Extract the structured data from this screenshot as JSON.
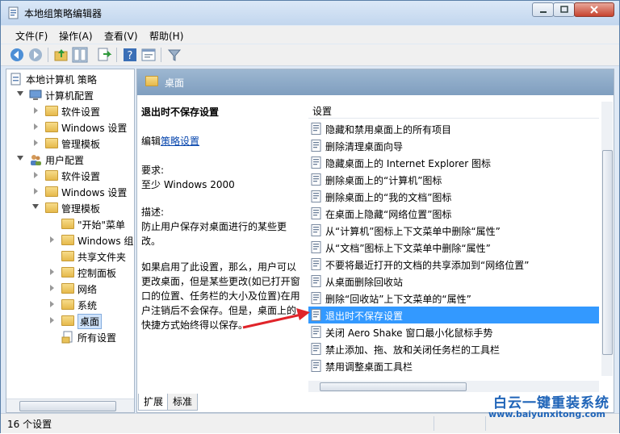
{
  "window": {
    "title": "本地组策略编辑器"
  },
  "menu": [
    "文件(F)",
    "操作(A)",
    "查看(V)",
    "帮助(H)"
  ],
  "toolbar": {
    "icons": [
      "back-icon",
      "forward-icon",
      "up-folder-icon",
      "show-hide-tree-icon",
      "export-list-icon",
      "help-icon",
      "properties-icon",
      "filter-icon"
    ]
  },
  "tree": {
    "root": "本地计算机 策略",
    "computer_config": "计算机配置",
    "cc_software": "软件设置",
    "cc_windows": "Windows 设置",
    "cc_admin": "管理模板",
    "user_config": "用户配置",
    "uc_software": "软件设置",
    "uc_windows": "Windows 设置",
    "uc_admin": "管理模板",
    "start_menu": "\"开始\"菜单",
    "windows_components": "Windows 组件",
    "shared_folders": "共享文件夹",
    "control_panel": "控制面板",
    "network": "网络",
    "system": "系统",
    "desktop": "桌面",
    "all_settings": "所有设置"
  },
  "panel": {
    "header": "桌面"
  },
  "description": {
    "title": "退出时不保存设置",
    "edit_prefix": "编辑",
    "edit_link": "策略设置",
    "req_label": "要求:",
    "req_value": "至少 Windows 2000",
    "desc_label": "描述:",
    "desc_text": "防止用户保存对桌面进行的某些更改。",
    "desc_more": "如果启用了此设置，那么，用户可以更改桌面，但是某些更改(如已打开窗口的位置、任务栏的大小及位置)在用户注销后不会保存。但是，桌面上的快捷方式始终得以保存。"
  },
  "list": {
    "column": "设置",
    "items": [
      "隐藏和禁用桌面上的所有项目",
      "删除清理桌面向导",
      "隐藏桌面上的 Internet Explorer 图标",
      "删除桌面上的“计算机”图标",
      "删除桌面上的“我的文档”图标",
      "在桌面上隐藏“网络位置”图标",
      "从“计算机”图标上下文菜单中删除“属性”",
      "从“文档”图标上下文菜单中删除“属性”",
      "不要将最近打开的文档的共享添加到“网络位置”",
      "从桌面删除回收站",
      "删除“回收站”上下文菜单的“属性”",
      "退出时不保存设置",
      "关闭 Aero Shake 窗口最小化鼠标手势",
      "禁止添加、拖、放和关闭任务栏的工具栏",
      "禁用调整桌面工具栏"
    ],
    "selected_index": 11
  },
  "tabs": [
    "扩展",
    "标准"
  ],
  "status": {
    "text": "16 个设置"
  },
  "watermark": {
    "title": "白云一键重装系统",
    "url": "www.baiyunxitong.com"
  },
  "colors": {
    "selection": "#3399ff",
    "header": "#8aa8c8",
    "arrow": "#e0242a",
    "watermark": "#1f64b8"
  }
}
